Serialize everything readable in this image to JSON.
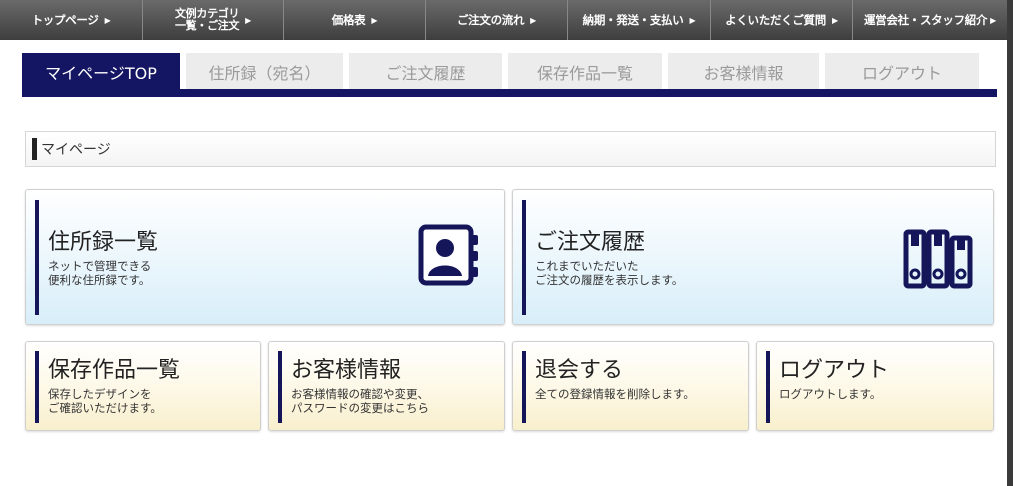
{
  "nav": {
    "items": [
      {
        "label": "トップページ",
        "width": 143
      },
      {
        "label1": "文例カテゴリ",
        "label2": "一覧・ご注文",
        "width": 141
      },
      {
        "label": "価格表",
        "width": 142
      },
      {
        "label": "ご注文の流れ",
        "width": 142
      },
      {
        "label": "納期・発送・支払い",
        "width": 143
      },
      {
        "label": "よくいただくご質問",
        "width": 142
      },
      {
        "label": "運営会社・スタッフ紹介",
        "width": 154
      }
    ]
  },
  "tabs": [
    {
      "label": "マイページTOP"
    },
    {
      "label": "住所録（宛名）"
    },
    {
      "label": "ご注文履歴"
    },
    {
      "label": "保存作品一覧"
    },
    {
      "label": "お客様情報"
    },
    {
      "label": "ログアウト"
    }
  ],
  "section": {
    "title": "マイページ"
  },
  "cards": {
    "address": {
      "title": "住所録一覧",
      "desc1": "ネットで管理できる",
      "desc2": "便利な住所録です。",
      "icon": "address-book-icon"
    },
    "orders": {
      "title": "ご注文履歴",
      "desc1": "これまでいただいた",
      "desc2": "ご注文の履歴を表示します。",
      "icon": "binders-icon"
    },
    "saved": {
      "title": "保存作品一覧",
      "desc1": "保存したデザインを",
      "desc2": "ご確認いただけます。"
    },
    "customer": {
      "title": "お客様情報",
      "desc1": "お客様情報の確認や変更、",
      "desc2": "パスワードの変更はこちら"
    },
    "withdraw": {
      "title": "退会する",
      "desc1": "全ての登録情報を削除します。"
    },
    "logout": {
      "title": "ログアウト",
      "desc1": "ログアウトします。"
    }
  },
  "colors": {
    "accent": "#141563",
    "card_blue": "#d8eef9",
    "card_yellow": "#f8efcc"
  }
}
